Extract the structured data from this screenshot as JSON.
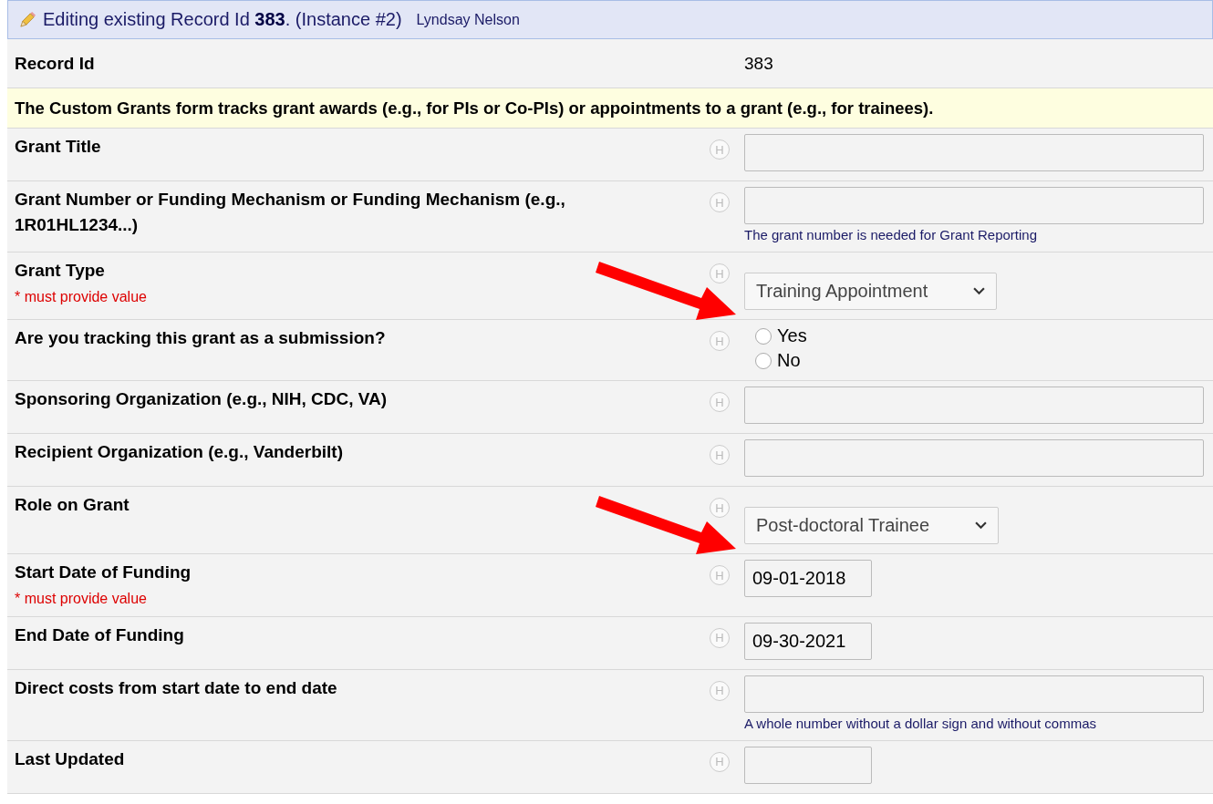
{
  "header": {
    "title": "Editing existing Record Id **383**. (Instance #2)",
    "user": "Lyndsay Nelson"
  },
  "record": {
    "label": "Record Id",
    "value": "383"
  },
  "notice": "The Custom Grants form tracks grant awards (e.g., for PIs or Co-PIs) or appointments to a grant (e.g., for trainees).",
  "fields": [
    {
      "label": "Grant Title",
      "help": "H",
      "kind": "text"
    },
    {
      "label": "Grant Number or Funding Mechanism or Funding Mechanism (e.g., 1R01HL1234...)",
      "help": "H",
      "kind": "text",
      "note": "The grant number is needed for Grant Reporting"
    },
    {
      "label": "Grant Type",
      "help": "H",
      "kind": "select",
      "value": "Training Appointment",
      "required": "* must provide value",
      "arrow": true
    },
    {
      "label": "Are you tracking this grant as a submission?",
      "help": "H",
      "kind": "radio",
      "options": [
        {
          "label": "Yes",
          "selected": false
        },
        {
          "label": "No",
          "selected": false
        }
      ]
    },
    {
      "label": "Sponsoring Organization (e.g., NIH, CDC, VA)",
      "help": "H",
      "kind": "text"
    },
    {
      "label": "Recipient Organization (e.g., Vanderbilt)",
      "help": "H",
      "kind": "text"
    },
    {
      "label": "Role on Grant",
      "help": "H",
      "kind": "select",
      "value": "Post-doctoral Trainee",
      "arrow": true
    },
    {
      "label": "Start Date of Funding",
      "help": "H",
      "kind": "date",
      "value": "09-01-2018",
      "required": "* must provide value"
    },
    {
      "label": "End Date of Funding",
      "help": "H",
      "kind": "date",
      "value": "09-30-2021"
    },
    {
      "label": "Direct costs from start date to end date",
      "help": "H",
      "kind": "text",
      "note": "A whole number without a dollar sign and without commas"
    },
    {
      "label": "Last Updated",
      "help": "H",
      "kind": "date"
    }
  ]
}
